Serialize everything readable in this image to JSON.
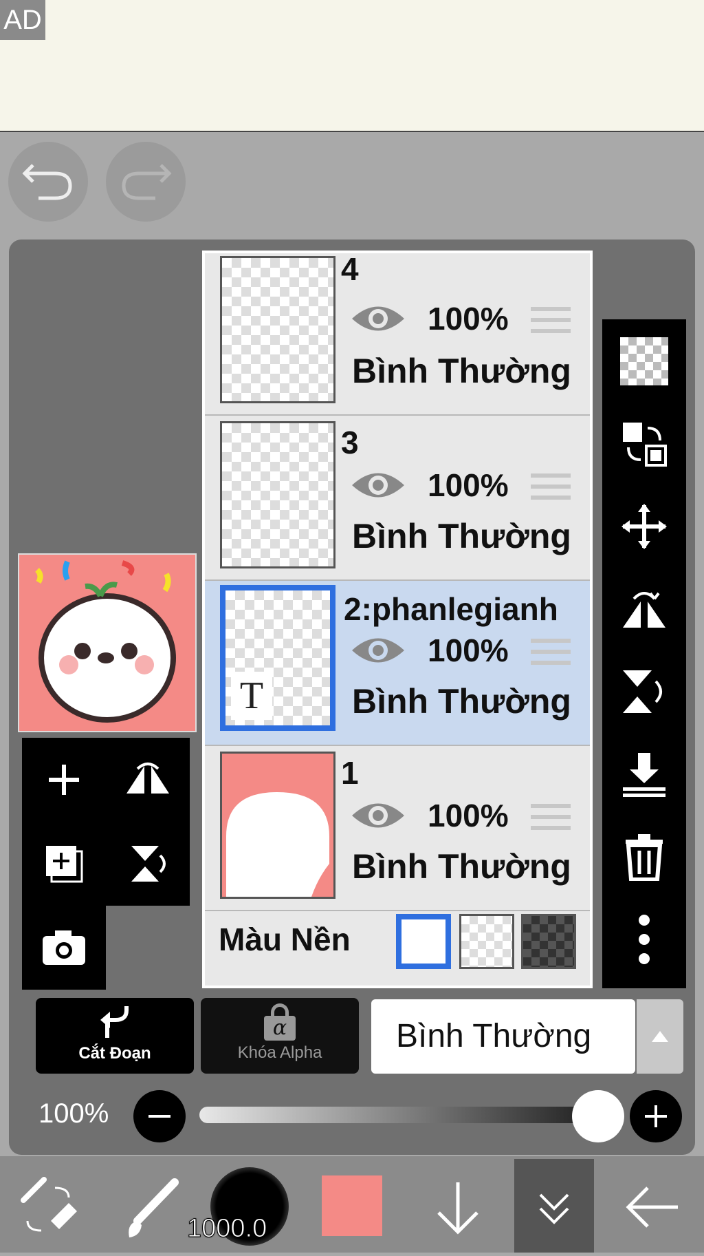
{
  "ad": {
    "label": "AD"
  },
  "layers": [
    {
      "name": "4",
      "opacity": "100%",
      "blend": "Bình Thường"
    },
    {
      "name": "3",
      "opacity": "100%",
      "blend": "Bình Thường"
    },
    {
      "name": "2:phanlegianh",
      "opacity": "100%",
      "blend": "Bình Thường",
      "selected": true,
      "text_badge": "T"
    },
    {
      "name": "1",
      "opacity": "100%",
      "blend": "Bình Thường"
    }
  ],
  "background": {
    "label": "Màu Nền"
  },
  "controls": {
    "clip_label": "Cắt Đoạn",
    "alpha_lock_label": "Khóa Alpha",
    "alpha_symbol": "α",
    "blend_mode": "Bình Thường",
    "opacity_value": "100%"
  },
  "bottom": {
    "brush_size": "1000.0",
    "color": "#f48a86"
  },
  "colors": {
    "selected": "#2f6fdf",
    "canvas": "#f48a86"
  }
}
